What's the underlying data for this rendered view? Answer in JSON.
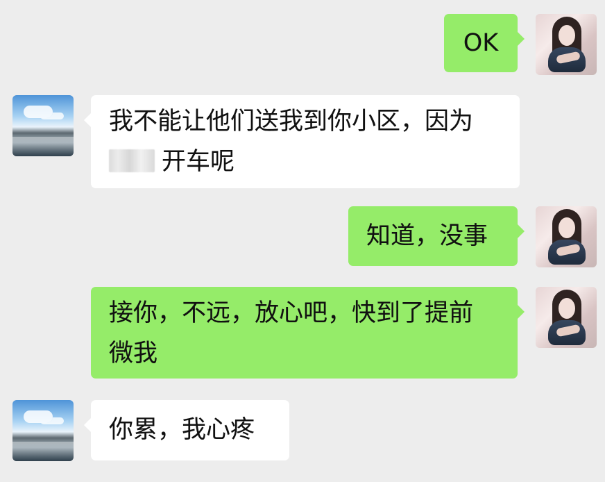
{
  "chat": {
    "messages": [
      {
        "side": "right",
        "text": "OK"
      },
      {
        "side": "left",
        "text": "我不能让他们送我到你小区，因为",
        "text2": "开车呢"
      },
      {
        "side": "right",
        "text": "知道，没事"
      },
      {
        "side": "right",
        "text": "接你，不远，放心吧，快到了提前",
        "text2": "微我"
      },
      {
        "side": "left",
        "text": "你累，我心疼"
      }
    ]
  }
}
